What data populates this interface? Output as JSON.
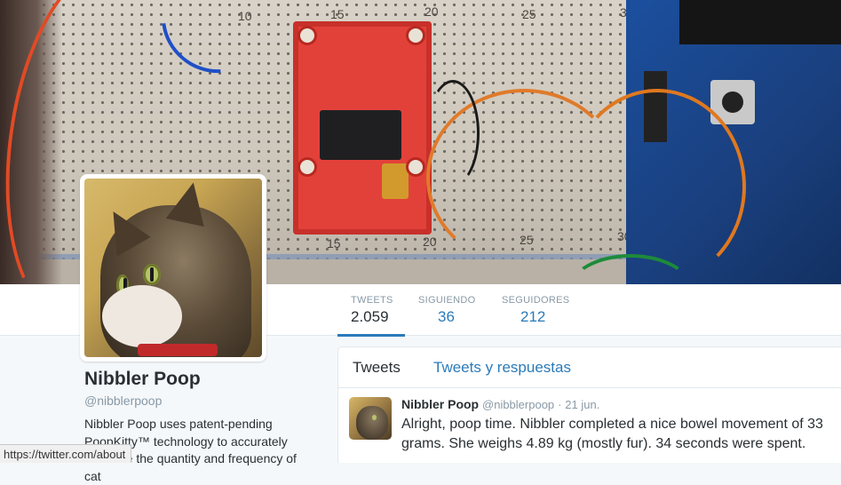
{
  "profile": {
    "name": "Nibbler Poop",
    "handle": "@nibblerpoop",
    "bio": "Nibbler Poop uses patent-pending PoopKitty™ technology to accurately measure the quantity and frequency of cat"
  },
  "stats": [
    {
      "label": "TWEETS",
      "value": "2.059"
    },
    {
      "label": "SIGUIENDO",
      "value": "36"
    },
    {
      "label": "SEGUIDORES",
      "value": "212"
    }
  ],
  "timeline": {
    "tabs": [
      "Tweets",
      "Tweets y respuestas"
    ]
  },
  "tweet": {
    "name": "Nibbler Poop",
    "handle": "@nibblerpoop",
    "separator": "·",
    "time": "21 jun.",
    "text": "Alright, poop time. Nibbler completed a nice bowel movement of 33 grams. She weighs 4.89 kg (mostly fur). 34 seconds were spent."
  },
  "banner": {
    "board_numbers": [
      "10",
      "15",
      "20",
      "15",
      "20",
      "25",
      "30",
      "25",
      "30"
    ]
  },
  "status_bar": {
    "url": "https://twitter.com/about"
  },
  "colors": {
    "link": "#2b7bb9",
    "text": "#292f33",
    "muted": "#8899a6",
    "background": "#f5f8fa"
  }
}
